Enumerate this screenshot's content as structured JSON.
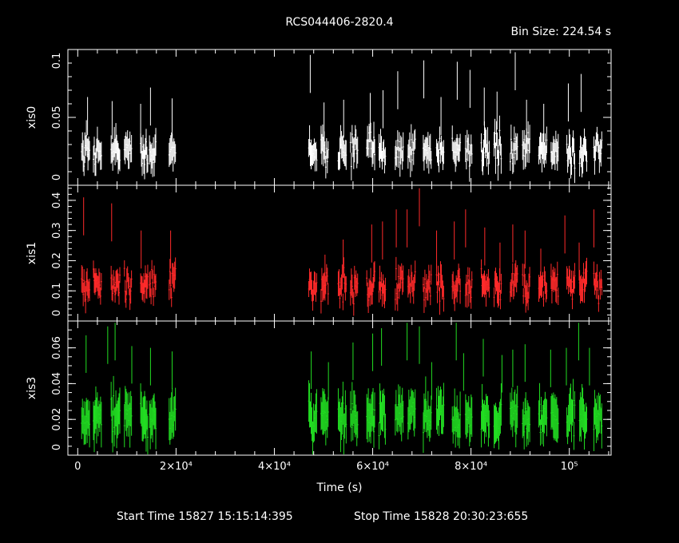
{
  "chart_data": {
    "type": "scatter",
    "title": "RCS044406-2820.4",
    "bin_size_label": "Bin Size: 224.54 s",
    "xlabel": "Time (s)",
    "xlim": [
      -2000,
      108500
    ],
    "x_tick_labels": [
      "0",
      "2×10⁴",
      "4×10⁴",
      "6×10⁴",
      "8×10⁴",
      "10⁵"
    ],
    "x_tick_values": [
      0,
      20000,
      40000,
      60000,
      80000,
      100000
    ],
    "start_time_label": "Start Time 15827 15:15:14:395",
    "stop_time_label": "Stop Time 15828 20:30:23:655",
    "segments": [
      [
        800,
        2400
      ],
      [
        3200,
        4800
      ],
      [
        6800,
        8600
      ],
      [
        9500,
        11000
      ],
      [
        12800,
        14300
      ],
      [
        14600,
        16000
      ],
      [
        18600,
        20000
      ],
      [
        47000,
        48600
      ],
      [
        49500,
        51000
      ],
      [
        53000,
        54600
      ],
      [
        55500,
        57000
      ],
      [
        58800,
        60400
      ],
      [
        61300,
        62700
      ],
      [
        64600,
        66200
      ],
      [
        67200,
        68700
      ],
      [
        70300,
        72000
      ],
      [
        73000,
        74500
      ],
      [
        76200,
        77800
      ],
      [
        78900,
        80300
      ],
      [
        82100,
        83700
      ],
      [
        84700,
        86200
      ],
      [
        88000,
        89500
      ],
      [
        90500,
        92000
      ],
      [
        93800,
        95400
      ],
      [
        96300,
        97800
      ],
      [
        99500,
        101100
      ],
      [
        102100,
        103600
      ],
      [
        105000,
        106600
      ]
    ],
    "panels": [
      {
        "name": "xis0",
        "color": "#ffffff",
        "ylim": [
          0,
          0.1
        ],
        "y_ticks": [
          0,
          0.05,
          0.1
        ],
        "y_tick_labels": [
          "0",
          "0.05",
          "0.1"
        ],
        "y_minor": 0.01,
        "typical": 0.03,
        "err": 0.009,
        "peaks": [
          [
            2000,
            0.065
          ],
          [
            7000,
            0.062
          ],
          [
            12800,
            0.06
          ],
          [
            14800,
            0.072
          ],
          [
            19200,
            0.064
          ],
          [
            47300,
            0.096
          ],
          [
            50100,
            0.061
          ],
          [
            54100,
            0.063
          ],
          [
            59500,
            0.068
          ],
          [
            62100,
            0.07
          ],
          [
            65100,
            0.084
          ],
          [
            70400,
            0.092
          ],
          [
            73900,
            0.065
          ],
          [
            77200,
            0.091
          ],
          [
            79800,
            0.085
          ],
          [
            82700,
            0.072
          ],
          [
            85300,
            0.069
          ],
          [
            89000,
            0.098
          ],
          [
            91300,
            0.063
          ],
          [
            94800,
            0.06
          ],
          [
            99800,
            0.075
          ],
          [
            102400,
            0.082
          ]
        ]
      },
      {
        "name": "xis1",
        "color": "#ff2a2a",
        "ylim": [
          0,
          0.45
        ],
        "y_ticks": [
          0,
          0.1,
          0.2,
          0.3,
          0.4
        ],
        "y_tick_labels": [
          "0",
          "0.1",
          "0.2",
          "0.3",
          "0.4"
        ],
        "y_minor": 0.02,
        "typical": 0.14,
        "err": 0.035,
        "peaks": [
          [
            1200,
            0.41
          ],
          [
            6900,
            0.39
          ],
          [
            12900,
            0.3
          ],
          [
            18900,
            0.3
          ],
          [
            50300,
            0.22
          ],
          [
            54000,
            0.27
          ],
          [
            59800,
            0.32
          ],
          [
            62000,
            0.33
          ],
          [
            64800,
            0.37
          ],
          [
            67000,
            0.37
          ],
          [
            69500,
            0.44
          ],
          [
            73000,
            0.3
          ],
          [
            76600,
            0.33
          ],
          [
            78900,
            0.37
          ],
          [
            82800,
            0.31
          ],
          [
            85900,
            0.26
          ],
          [
            88500,
            0.32
          ],
          [
            91000,
            0.3
          ],
          [
            94200,
            0.24
          ],
          [
            99100,
            0.35
          ],
          [
            102000,
            0.26
          ],
          [
            105000,
            0.37
          ]
        ]
      },
      {
        "name": "xis3",
        "color": "#22dd22",
        "ylim": [
          0,
          0.075
        ],
        "y_ticks": [
          0,
          0.02,
          0.04,
          0.06
        ],
        "y_tick_labels": [
          "0",
          "0.02",
          "0.04",
          "0.06"
        ],
        "y_minor": 0.005,
        "typical": 0.025,
        "err": 0.01,
        "peaks": [
          [
            1700,
            0.067
          ],
          [
            6100,
            0.072
          ],
          [
            7600,
            0.074
          ],
          [
            11000,
            0.061
          ],
          [
            14800,
            0.06
          ],
          [
            19200,
            0.058
          ],
          [
            47500,
            0.058
          ],
          [
            51000,
            0.052
          ],
          [
            56000,
            0.063
          ],
          [
            60000,
            0.068
          ],
          [
            61800,
            0.071
          ],
          [
            67000,
            0.074
          ],
          [
            69500,
            0.072
          ],
          [
            72000,
            0.052
          ],
          [
            77000,
            0.074
          ],
          [
            78500,
            0.057
          ],
          [
            82500,
            0.065
          ],
          [
            86300,
            0.056
          ],
          [
            88500,
            0.059
          ],
          [
            91000,
            0.062
          ],
          [
            96200,
            0.059
          ],
          [
            99400,
            0.06
          ],
          [
            101900,
            0.074
          ],
          [
            104100,
            0.06
          ]
        ]
      }
    ]
  }
}
